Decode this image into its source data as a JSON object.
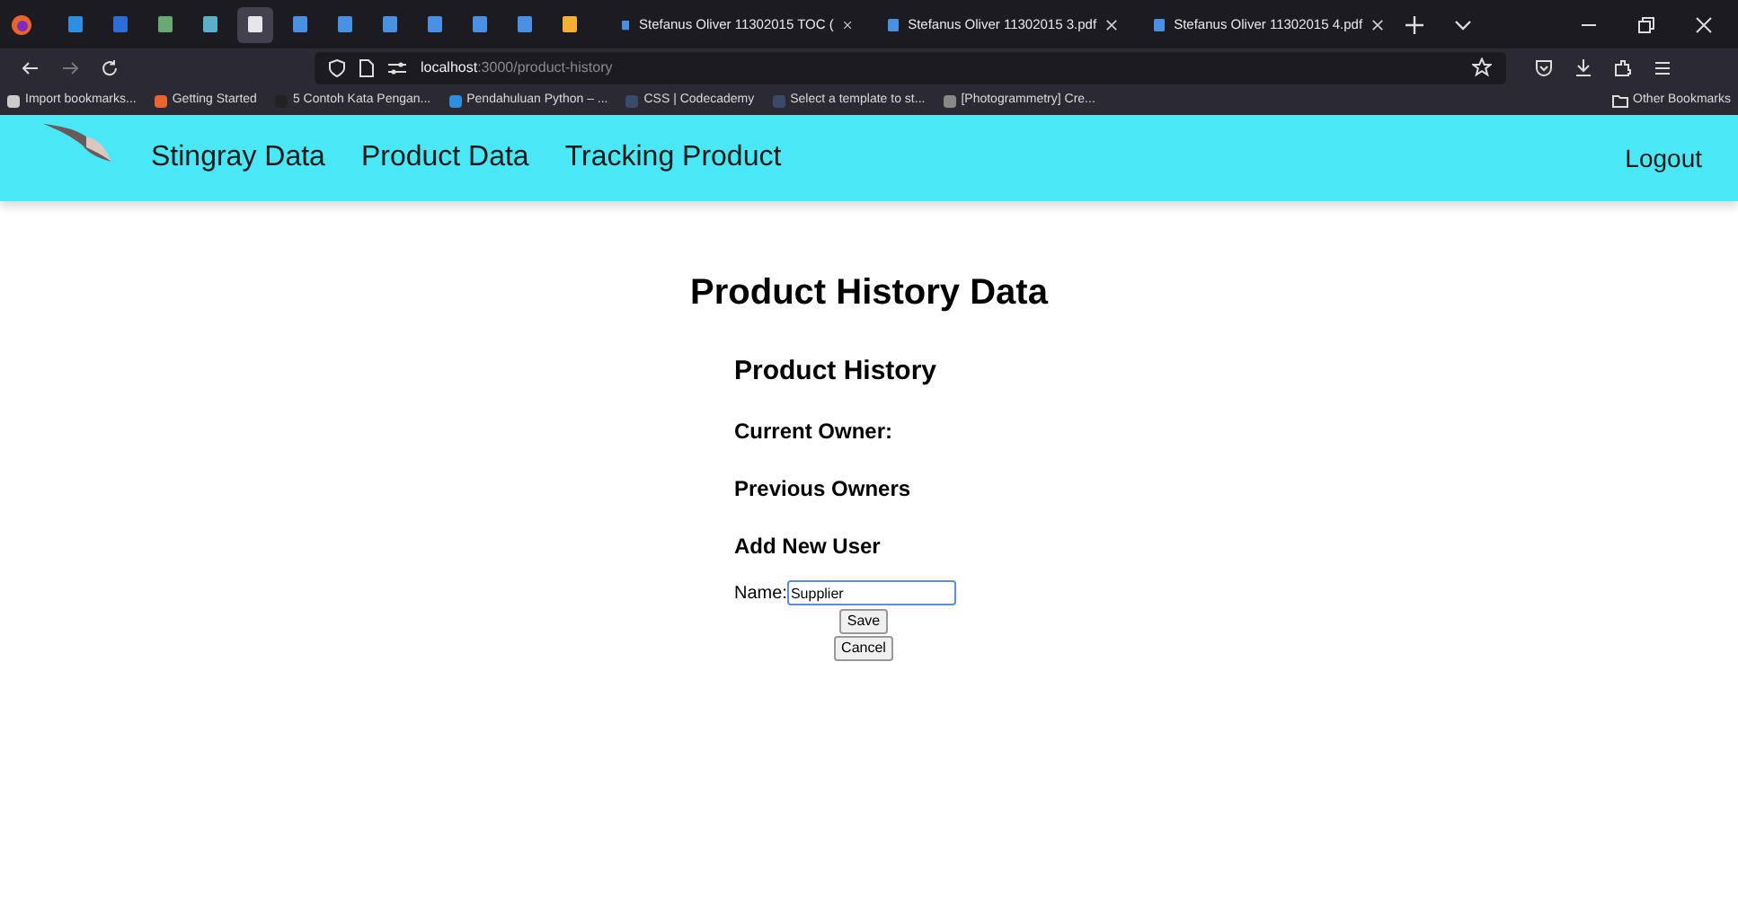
{
  "browser": {
    "pinned_tabs": [
      {
        "selected": false
      },
      {
        "selected": false
      },
      {
        "selected": false
      },
      {
        "selected": false
      },
      {
        "selected": true
      },
      {
        "selected": false
      },
      {
        "selected": false
      },
      {
        "selected": false
      },
      {
        "selected": false
      },
      {
        "selected": false
      },
      {
        "selected": false
      },
      {
        "selected": false
      }
    ],
    "tabs": [
      {
        "title": "Stefanus Oliver 11302015 TOC (",
        "selected": false
      },
      {
        "title": "Stefanus Oliver 11302015 3.pdf",
        "selected": false
      },
      {
        "title": "Stefanus Oliver 11302015 4.pdf",
        "selected": false
      }
    ],
    "address": {
      "host": "localhost",
      "path": ":3000/product-history"
    },
    "bookmarks": [
      "Import bookmarks...",
      "Getting Started",
      "5 Contoh Kata Pengan...",
      "Pendahuluan Python – ...",
      "CSS | Codecademy",
      "Select a template to st...",
      "[Photogrammetry] Cre..."
    ],
    "other_bookmarks": "Other Bookmarks"
  },
  "navbar": {
    "links": [
      "Stingray Data",
      "Product Data",
      "Tracking Product"
    ],
    "logout": "Logout"
  },
  "page": {
    "title": "Product History Data",
    "section_title": "Product History",
    "current_owner": "Current Owner:",
    "previous_owners": "Previous Owners",
    "add_user_title": "Add New User",
    "name_label": "Name:",
    "name_value": "Supplier",
    "save": "Save",
    "cancel": "Cancel"
  }
}
